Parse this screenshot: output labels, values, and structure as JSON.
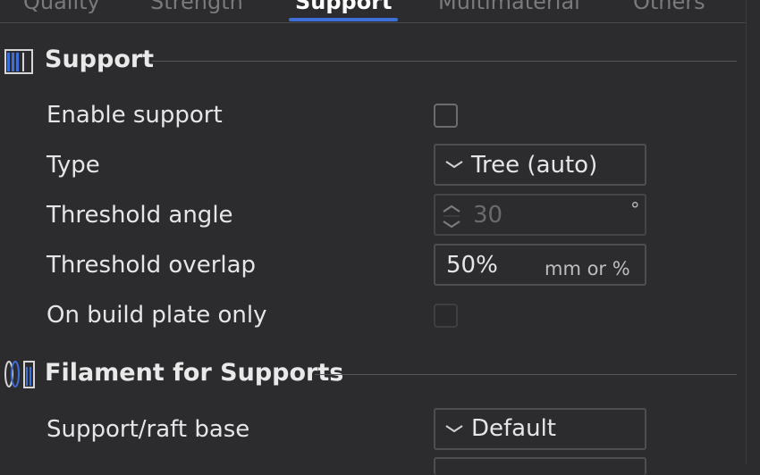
{
  "tabs": [
    {
      "label": "Quality"
    },
    {
      "label": "Strength"
    },
    {
      "label": "Support",
      "active": true
    },
    {
      "label": "Multimaterial"
    },
    {
      "label": "Others"
    }
  ],
  "sections": {
    "support": {
      "title": "Support",
      "icon": "support-icon",
      "enable_support": {
        "label": "Enable support",
        "checked": false
      },
      "type": {
        "label": "Type",
        "value": "Tree (auto)",
        "icon": "chevron-down-icon"
      },
      "threshold_angle": {
        "label": "Threshold angle",
        "value": "30",
        "unit": "°",
        "disabled": true,
        "icon": "spinner-icon"
      },
      "threshold_overlap": {
        "label": "Threshold overlap",
        "value": "50%",
        "unit": "mm or %"
      },
      "build_plate_only": {
        "label": "On build plate only",
        "checked": false,
        "disabled": true
      }
    },
    "filament": {
      "title": "Filament for Supports",
      "icon": "filament-icon",
      "raft_base": {
        "label": "Support/raft base",
        "value": "Default",
        "icon": "chevron-down-icon"
      }
    }
  },
  "colors": {
    "background": "#2c2c2f",
    "accent": "#3d6fd6",
    "text": "#e6e6e6",
    "border": "#4d4d52"
  }
}
